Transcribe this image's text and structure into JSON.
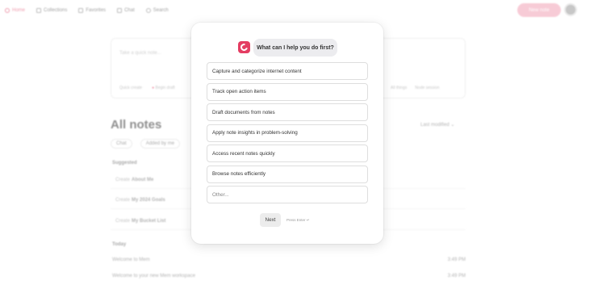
{
  "nav": {
    "items": [
      {
        "label": "Home",
        "icon": "home-icon"
      },
      {
        "label": "Collections",
        "icon": "grid-icon"
      },
      {
        "label": "Favorites",
        "icon": "grid-icon"
      },
      {
        "label": "Chat",
        "icon": "chat-icon"
      },
      {
        "label": "Search",
        "icon": "search-icon"
      }
    ],
    "new_note": "New note"
  },
  "composer": {
    "placeholder": "Take a quick note...",
    "chips": [
      "Quick create",
      "Begin draft"
    ],
    "chips_right": [
      "All things",
      "Node session"
    ]
  },
  "notes": {
    "title": "All notes",
    "sort": "Last modified",
    "filters": [
      "Chat",
      "Added by me"
    ],
    "suggested_label": "Suggested",
    "suggested": [
      {
        "prefix": "Create",
        "name": "About Me"
      },
      {
        "prefix": "Create",
        "name": "My 2024 Goals"
      },
      {
        "prefix": "Create",
        "name": "My Bucket List"
      }
    ],
    "today_label": "Today",
    "today": [
      {
        "title": "Welcome to Mem",
        "time": "3:49 PM"
      },
      {
        "title": "Welcome to your new Mem workspace",
        "time": "3:49 PM"
      }
    ]
  },
  "modal": {
    "question": "What can I help you do first?",
    "options": [
      "Capture and categorize internet content",
      "Track open action items",
      "Draft documents from notes",
      "Apply note insights in problem-solving",
      "Access recent notes quickly",
      "Browse notes efficiently"
    ],
    "other_placeholder": "Other...",
    "next_label": "Next",
    "hint": "Press Enter ↵"
  },
  "colors": {
    "accent": "#e43d62",
    "bubble": "#ececef"
  }
}
